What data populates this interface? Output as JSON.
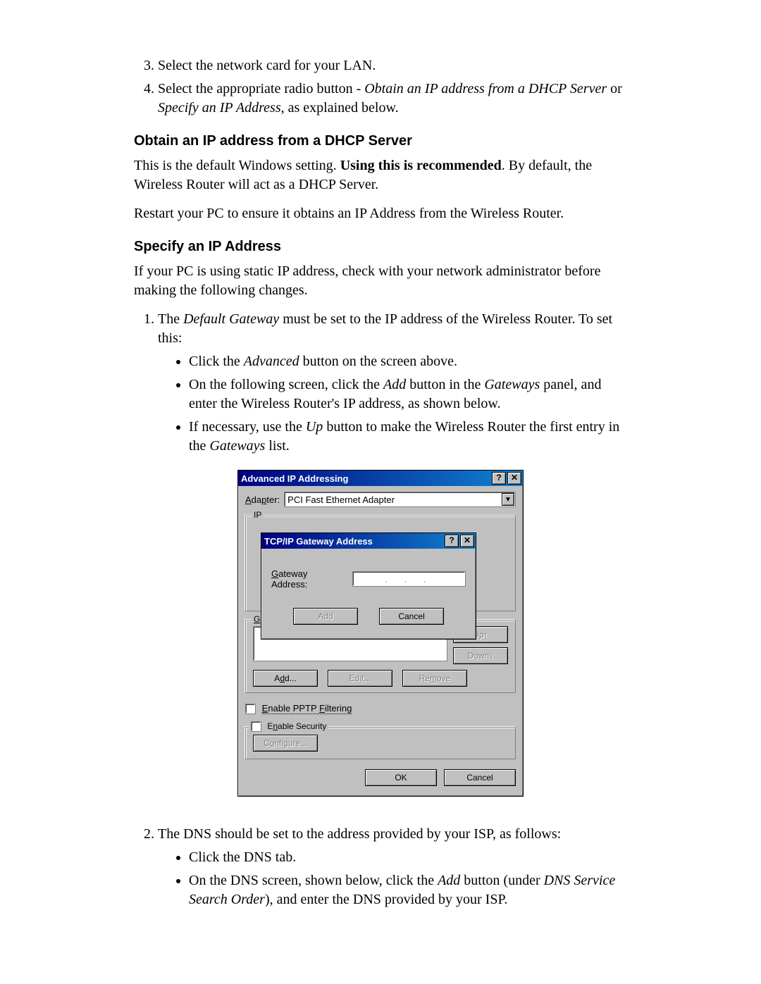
{
  "list1": {
    "start": 3,
    "item3": "Select the network card for your LAN.",
    "item4_a": "Select the appropriate radio button - ",
    "item4_i1": "Obtain an IP address from a DHCP Server",
    "item4_or": " or ",
    "item4_i2": "Specify an IP Address",
    "item4_b": ", as explained below."
  },
  "h_dhcp": "Obtain an IP address from a DHCP Server",
  "p_dhcp_a": "This is the default Windows setting. ",
  "p_dhcp_b": "Using this is recommended",
  "p_dhcp_c": ". By default, the Wireless Router will act as a DHCP Server.",
  "p_restart": "Restart your PC to ensure it obtains an IP Address from the Wireless Router.",
  "h_specify": "Specify an IP Address",
  "p_specify": "If your PC is using static IP address, check with your network administrator before making the following changes.",
  "ol2": {
    "start": 1,
    "item1_a": "The ",
    "item1_i": "Default Gateway",
    "item1_b": " must be set to the IP address of the Wireless Router. To set this:",
    "sub1_a": "Click the ",
    "sub1_i": "Advanced",
    "sub1_b": " button on the screen above.",
    "sub2_a": "On the following screen, click the ",
    "sub2_i1": "Add",
    "sub2_b": " button in the ",
    "sub2_i2": "Gateways",
    "sub2_c": " panel, and enter the Wireless Router's IP address, as shown below.",
    "sub3_a": "If necessary, use the ",
    "sub3_i": "Up",
    "sub3_b": " button to make the Wireless Router the first entry in the ",
    "sub3_i2": "Gateways",
    "sub3_c": " list."
  },
  "ol3": {
    "start": 2,
    "item2": "The DNS should be set to the address provided by your ISP, as follows:",
    "sub1": "Click the DNS tab.",
    "sub2_a": "On the DNS screen, shown below, click the ",
    "sub2_i1": "Add",
    "sub2_b": " button (under ",
    "sub2_i2": "DNS Service Search Order",
    "sub2_c": "), and enter the DNS provided by your ISP."
  },
  "dialog": {
    "main_title": "Advanced IP Addressing",
    "help": "?",
    "close": "✕",
    "adapter_label": "Adapter:",
    "adapter_value": "PCI Fast Ethernet Adapter",
    "ip_legend": "IP",
    "gateways_legend": "Gateways",
    "up": "Up↑",
    "down": "Down↓",
    "add": "Add...",
    "edit": "Edit...",
    "remove": "Remove",
    "pptp": "Enable PPTP Filtering",
    "security_legend": "Enable Security",
    "configure": "Configure...",
    "ok": "OK",
    "cancel": "Cancel",
    "modal_title": "TCP/IP Gateway Address",
    "ga_label": "Gateway Address:",
    "ip_placeholder": ".   .   .",
    "add_btn": "Add",
    "cancel_btn": "Cancel"
  }
}
